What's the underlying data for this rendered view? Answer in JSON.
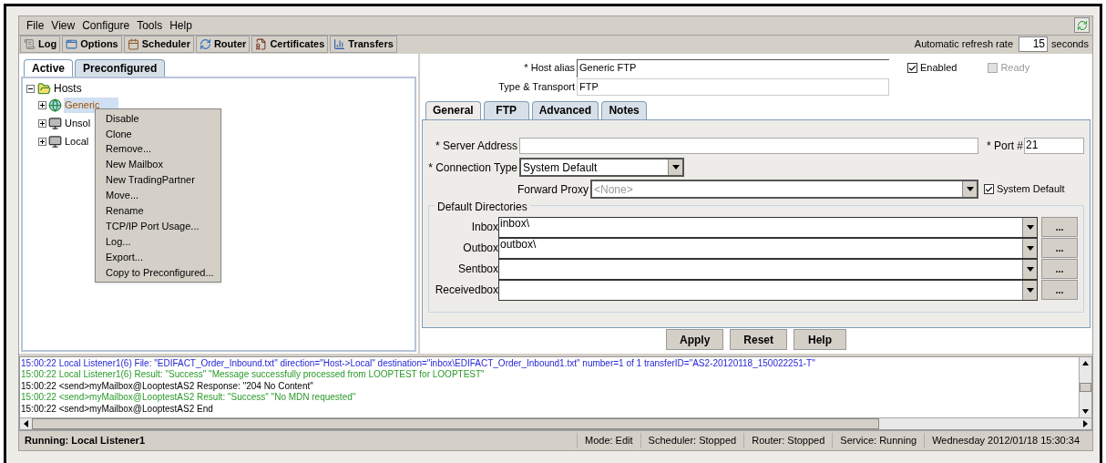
{
  "menu_bar": [
    "File",
    "View",
    "Configure",
    "Tools",
    "Help"
  ],
  "toolbar": [
    {
      "label": "Log",
      "kind": "log"
    },
    {
      "label": "Options",
      "kind": "options"
    },
    {
      "label": "Scheduler",
      "kind": "scheduler"
    },
    {
      "label": "Router",
      "kind": "router"
    },
    {
      "label": "Certificates",
      "kind": "certificates"
    },
    {
      "label": "Transfers",
      "kind": "transfers"
    }
  ],
  "refresh": {
    "label": "Automatic refresh rate",
    "value": "15",
    "unit": "seconds"
  },
  "left_tabs": [
    {
      "label": "Active",
      "selected": true
    },
    {
      "label": "Preconfigured",
      "selected": false
    }
  ],
  "tree": {
    "label": "Hosts",
    "expanded": true,
    "children": [
      {
        "label": "Generic",
        "kind": "globe",
        "selected": true
      },
      {
        "label": "Unsol",
        "kind": "monitor",
        "selected": false
      },
      {
        "label": "Local",
        "kind": "monitor",
        "selected": false
      }
    ]
  },
  "context_menu": [
    "Disable",
    "Clone",
    "Remove...",
    "New Mailbox",
    "New TradingPartner",
    "Move...",
    "Rename",
    "TCP/IP Port Usage...",
    "Log...",
    "Export...",
    "Copy to Preconfigured..."
  ],
  "host": {
    "alias_label": "* Host alias",
    "alias": "Generic FTP",
    "type_label": "Type & Transport",
    "type": "FTP",
    "enabled": {
      "label": "Enabled",
      "checked": true,
      "disabled": false
    },
    "ready": {
      "label": "Ready",
      "checked": false,
      "disabled": true
    }
  },
  "detail_tabs": [
    {
      "label": "General",
      "selected": true
    },
    {
      "label": "FTP",
      "selected": false
    },
    {
      "label": "Advanced",
      "selected": false
    },
    {
      "label": "Notes",
      "selected": false
    }
  ],
  "general": {
    "server_label": "* Server Address",
    "port_label": "* Port #",
    "port": "21",
    "connection_label": "* Connection Type",
    "connection": "System Default",
    "proxy_label": "Forward Proxy",
    "proxy_placeholder": "<None>",
    "system_default": {
      "label": "System Default",
      "checked": true
    },
    "directories_title": "Default Directories",
    "directories": [
      {
        "label": "Inbox",
        "value": "inbox\\",
        "browse": "..."
      },
      {
        "label": "Outbox",
        "value": "outbox\\",
        "browse": "..."
      },
      {
        "label": "Sentbox",
        "browse": "..."
      },
      {
        "label": "Receivedbox",
        "browse": "..."
      }
    ]
  },
  "buttons": [
    "Apply",
    "Reset",
    "Help"
  ],
  "log": [
    {
      "text": "15:00:22 Local Listener1(6) File: \"EDIFACT_Order_Inbound.txt\" direction=\"Host->Local\" destination=\"inbox\\EDIFACT_Order_Inbound1.txt\" number=1 of 1 transferID=\"AS2-20120118_150022251-T\"",
      "color": "#2626d6"
    },
    {
      "text": "15:00:22 Local Listener1(6) Result: \"Success\" \"Message successfully processed from LOOPTEST for LOOPTEST\"",
      "color": "#2a9a2a"
    },
    {
      "text": "15:00:22 <send>myMailbox@LooptestAS2 Response: \"204 No Content\"",
      "color": "#000000"
    },
    {
      "text": "15:00:22 <send>myMailbox@LooptestAS2 Result: \"Success\" \"No MDN requested\"",
      "color": "#2a9a2a"
    },
    {
      "text": "15:00:22 <send>myMailbox@LooptestAS2 End",
      "color": "#000000"
    }
  ],
  "status_bar": {
    "running": "Running: Local Listener1",
    "items": [
      "Mode: Edit",
      "Scheduler: Stopped",
      "Router: Stopped",
      "Service: Running",
      "Wednesday 2012/01/18 15:30:34"
    ]
  }
}
